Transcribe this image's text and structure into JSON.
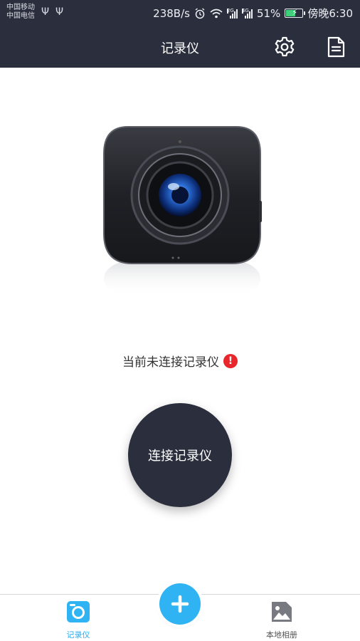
{
  "status_bar": {
    "carrier_1": "中国移动",
    "carrier_2": "中国电信",
    "speed": "238B/s",
    "battery": "51%",
    "time": "傍晚6:30",
    "signal_tag_1": "2G",
    "signal_tag_2": "4G"
  },
  "header": {
    "title": "记录仪",
    "settings_icon": "gear-icon",
    "doc_icon": "document-icon"
  },
  "main": {
    "status_message": "当前未连接记录仪",
    "warning_icon": "exclamation-icon",
    "connect_button": "连接记录仪"
  },
  "bottom_nav": {
    "items": [
      {
        "label": "记录仪",
        "icon": "camera-icon",
        "active": true
      },
      {
        "label": "本地相册",
        "icon": "gallery-icon",
        "active": false
      }
    ],
    "add_icon": "plus-icon"
  },
  "colors": {
    "bar": "#2b2f3d",
    "accent": "#2fb3f2",
    "warning": "#e8262b"
  }
}
